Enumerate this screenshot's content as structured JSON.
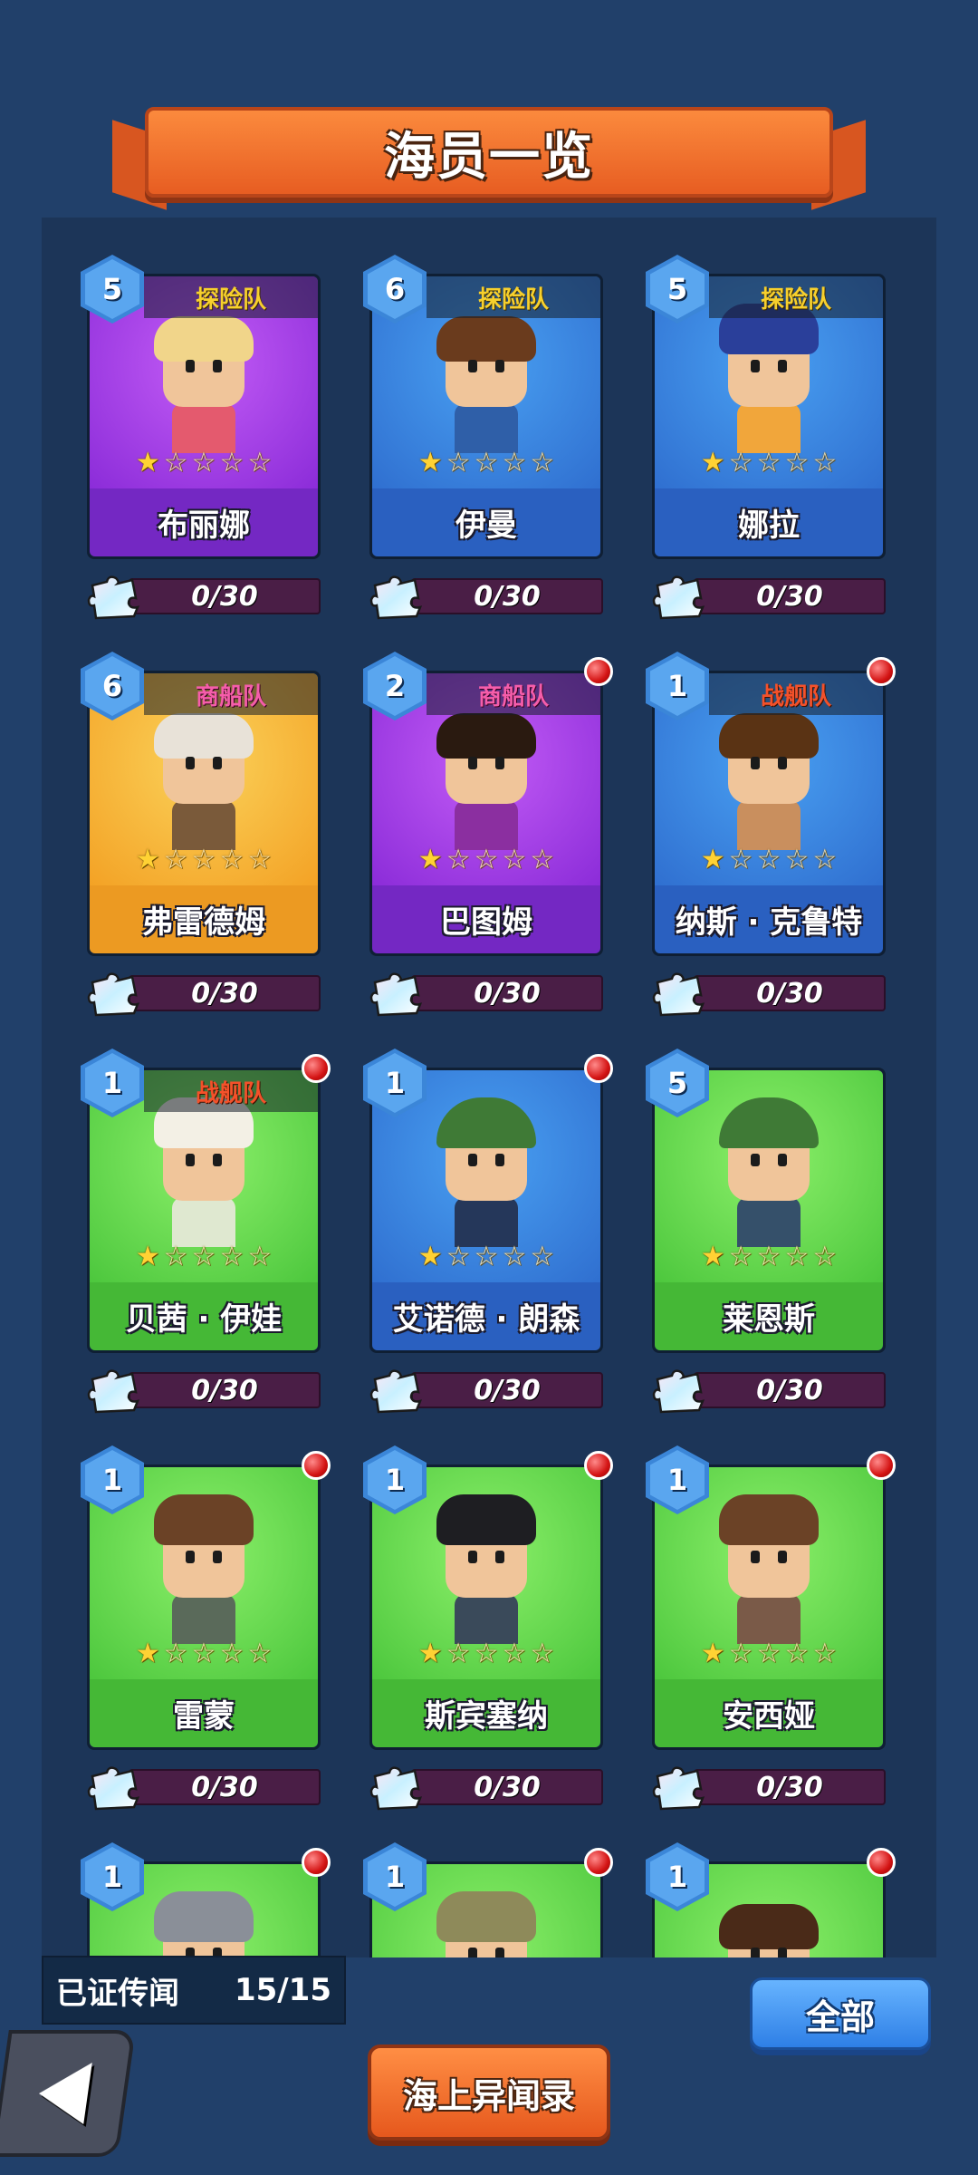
{
  "title": "海员一览",
  "crew": [
    {
      "name": "布丽娜",
      "level": "5",
      "faction": "探险队",
      "faction_color": "gold",
      "theme": "purple",
      "stars": 1,
      "progress": "0/30",
      "has_alert": false,
      "hair": "#f1d58a",
      "outfit": "#e45a6e",
      "hat": "none"
    },
    {
      "name": "伊曼",
      "level": "6",
      "faction": "探险队",
      "faction_color": "gold",
      "theme": "blue",
      "stars": 1,
      "progress": "0/30",
      "has_alert": false,
      "hair": "#6a3b1d",
      "outfit": "#2f5fa8",
      "hat": "none"
    },
    {
      "name": "娜拉",
      "level": "5",
      "faction": "探险队",
      "faction_color": "gold",
      "theme": "blue",
      "stars": 1,
      "progress": "0/30",
      "has_alert": false,
      "hair": "#f4d98e",
      "outfit": "#f1a63b",
      "hat": "tricorn-blue"
    },
    {
      "name": "弗雷德姆",
      "level": "6",
      "faction": "商船队",
      "faction_color": "pink",
      "theme": "orange",
      "stars": 1,
      "progress": "0/30",
      "has_alert": false,
      "hair": "#e8e2d8",
      "outfit": "#7a5a3a",
      "hat": "none"
    },
    {
      "name": "巴图姆",
      "level": "2",
      "faction": "商船队",
      "faction_color": "pink",
      "theme": "purple",
      "stars": 1,
      "progress": "0/30",
      "has_alert": true,
      "hair": "#2a1a10",
      "outfit": "#8b2fa0",
      "hat": "none"
    },
    {
      "name": "纳斯 · 克鲁特",
      "level": "1",
      "faction": "战舰队",
      "faction_color": "red",
      "theme": "blue",
      "stars": 1,
      "progress": "0/30",
      "has_alert": true,
      "hair": "#5a3314",
      "outfit": "#c98f5e",
      "hat": "none"
    },
    {
      "name": "贝茜 · 伊娃",
      "level": "1",
      "faction": "战舰队",
      "faction_color": "red",
      "theme": "green",
      "stars": 1,
      "progress": "0/30",
      "has_alert": true,
      "hair": "#f3f0e5",
      "outfit": "#dfe8d0",
      "hat": "hood"
    },
    {
      "name": "艾诺德 · 朗森",
      "level": "1",
      "faction": "",
      "faction_color": "",
      "theme": "blue",
      "stars": 1,
      "progress": "0/30",
      "has_alert": true,
      "hair": "#b85a2a",
      "outfit": "#25375a",
      "hat": "pointed-green"
    },
    {
      "name": "莱恩斯",
      "level": "5",
      "faction": "",
      "faction_color": "",
      "theme": "green",
      "stars": 1,
      "progress": "0/30",
      "has_alert": false,
      "hair": "#b85a2a",
      "outfit": "#35506a",
      "hat": "pointed-green"
    },
    {
      "name": "雷蒙",
      "level": "1",
      "faction": "",
      "faction_color": "",
      "theme": "green",
      "stars": 1,
      "progress": "0/30",
      "has_alert": true,
      "hair": "#7a4a24",
      "outfit": "#5a6a5a",
      "hat": "brown"
    },
    {
      "name": "斯宾塞纳",
      "level": "1",
      "faction": "",
      "faction_color": "",
      "theme": "green",
      "stars": 1,
      "progress": "0/30",
      "has_alert": true,
      "hair": "#d8622a",
      "outfit": "#3a4a5a",
      "hat": "pirate"
    },
    {
      "name": "安西娅",
      "level": "1",
      "faction": "",
      "faction_color": "",
      "theme": "green",
      "stars": 1,
      "progress": "0/30",
      "has_alert": true,
      "hair": "#4a2a18",
      "outfit": "#7a5a48",
      "hat": "brown"
    },
    {
      "name": "",
      "level": "1",
      "faction": "",
      "faction_color": "",
      "theme": "green",
      "stars": 0,
      "progress": "",
      "has_alert": true,
      "hair": "#3a3a3a",
      "outfit": "#5a5a5a",
      "hat": "helmet"
    },
    {
      "name": "",
      "level": "1",
      "faction": "",
      "faction_color": "",
      "theme": "green",
      "stars": 0,
      "progress": "",
      "has_alert": true,
      "hair": "#7a7a4a",
      "outfit": "#5a5a5a",
      "hat": "khaki"
    },
    {
      "name": "",
      "level": "1",
      "faction": "",
      "faction_color": "",
      "theme": "green",
      "stars": 0,
      "progress": "",
      "has_alert": true,
      "hair": "#4a2a18",
      "outfit": "#5a5a5a",
      "hat": "none"
    }
  ],
  "footer": {
    "status_label": "已证传闻",
    "status_value": "15/15",
    "all_button_label": "全部",
    "chronicle_button_label": "海上异闻录"
  }
}
